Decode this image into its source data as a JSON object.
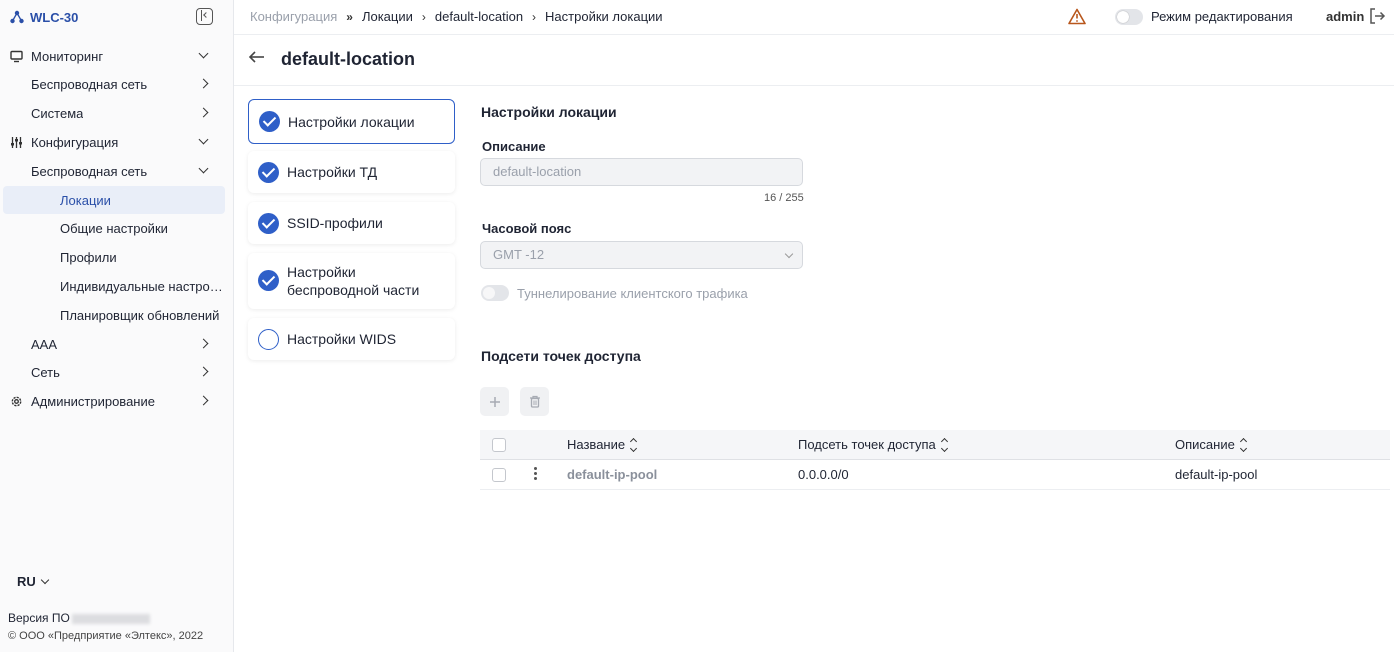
{
  "app": {
    "name": "WLC-30"
  },
  "sidebar": {
    "items": [
      {
        "label": "Мониторинг",
        "icon": "monitor-icon",
        "chevron": "down"
      },
      {
        "label": "Беспроводная сеть",
        "chevron": "right"
      },
      {
        "label": "Система",
        "chevron": "right"
      },
      {
        "label": "Конфигурация",
        "icon": "sliders-icon",
        "chevron": "down"
      },
      {
        "label": "Беспроводная сеть",
        "chevron": "down"
      },
      {
        "label": "Локации",
        "active": true
      },
      {
        "label": "Общие настройки"
      },
      {
        "label": "Профили"
      },
      {
        "label": "Индивидуальные настройки"
      },
      {
        "label": "Планировщик обновлений"
      },
      {
        "label": "AAA",
        "chevron": "right"
      },
      {
        "label": "Сеть",
        "chevron": "right"
      },
      {
        "label": "Администрирование",
        "icon": "gear-icon",
        "chevron": "right"
      }
    ],
    "language": "RU",
    "version_label": "Версия ПО",
    "copyright": "© ООО «Предприятие «Элтекс», 2022"
  },
  "topbar": {
    "breadcrumbs": [
      "Конфигурация",
      "Локации",
      "default-location",
      "Настройки локации"
    ],
    "edit_mode_label": "Режим редактирования",
    "user": "admin"
  },
  "page": {
    "title": "default-location"
  },
  "steps": [
    {
      "label": "Настройки локации",
      "done": true,
      "active": true
    },
    {
      "label": "Настройки ТД",
      "done": true
    },
    {
      "label": "SSID-профили",
      "done": true
    },
    {
      "label": "Настройки беспроводной части",
      "done": true
    },
    {
      "label": "Настройки WIDS",
      "done": false
    }
  ],
  "form": {
    "section_title": "Настройки локации",
    "description_label": "Описание",
    "description_value": "default-location",
    "counter": "16 / 255",
    "timezone_label": "Часовой пояс",
    "timezone_value": "GMT -12",
    "tunnel_label": "Туннелирование клиентского трафика"
  },
  "subnets": {
    "title": "Подсети точек доступа",
    "columns": [
      "Название",
      "Подсеть точек доступа",
      "Описание"
    ],
    "rows": [
      {
        "name": "default-ip-pool",
        "subnet": "0.0.0.0/0",
        "description": "default-ip-pool"
      }
    ]
  },
  "colors": {
    "accent": "#2f5fc8",
    "warning": "#b8561b"
  }
}
